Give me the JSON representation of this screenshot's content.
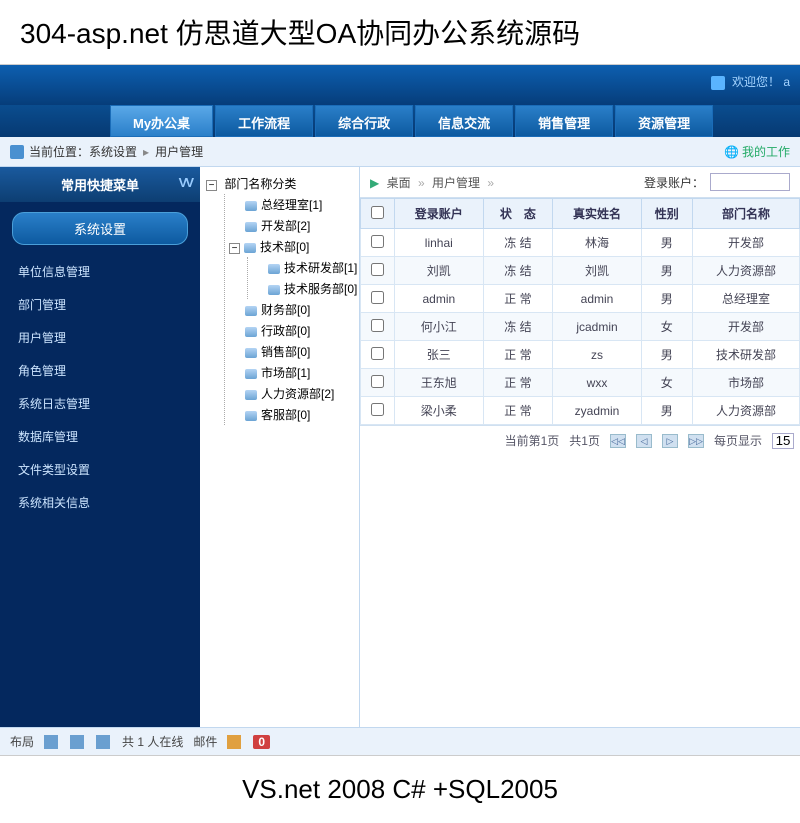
{
  "topTitle": "304-asp.net 仿思道大型OA协同办公系统源码",
  "bottomTitle": "VS.net 2008 C# +SQL2005",
  "welcome": "欢迎您！",
  "welcomeUser": "a",
  "navTabs": [
    "My办公桌",
    "工作流程",
    "综合行政",
    "信息交流",
    "销售管理",
    "资源管理"
  ],
  "location": {
    "label": "当前位置：",
    "path1": "系统设置",
    "path2": "用户管理",
    "myWork": "我的工作"
  },
  "sidebar": {
    "quickMenuTitle": "常用快捷菜单",
    "sysSetting": "系统设置",
    "items": [
      "单位信息管理",
      "部门管理",
      "用户管理",
      "角色管理",
      "系统日志管理",
      "数据库管理",
      "文件类型设置",
      "系统相关信息"
    ]
  },
  "tree": {
    "root": "部门名称分类",
    "nodes": [
      {
        "label": "总经理室[1]",
        "children": []
      },
      {
        "label": "开发部[2]",
        "children": []
      },
      {
        "label": "技术部[0]",
        "expanded": true,
        "children": [
          {
            "label": "技术研发部[1]"
          },
          {
            "label": "技术服务部[0]"
          }
        ]
      },
      {
        "label": "财务部[0]",
        "children": []
      },
      {
        "label": "行政部[0]",
        "children": []
      },
      {
        "label": "销售部[0]",
        "children": []
      },
      {
        "label": "市场部[1]",
        "children": []
      },
      {
        "label": "人力资源部[2]",
        "children": []
      },
      {
        "label": "客服部[0]",
        "children": []
      }
    ]
  },
  "breadcrumb": {
    "desktop": "桌面",
    "current": "用户管理",
    "searchLabel": "登录账户："
  },
  "table": {
    "headers": [
      "",
      "登录账户",
      "状　态",
      "真实姓名",
      "性别",
      "部门名称"
    ],
    "rows": [
      {
        "account": "linhai",
        "status": "冻 结",
        "statusClass": "frozen",
        "realname": "林海",
        "gender": "男",
        "dept": "开发部"
      },
      {
        "account": "刘凯",
        "status": "冻 结",
        "statusClass": "frozen",
        "realname": "刘凯",
        "gender": "男",
        "dept": "人力资源部"
      },
      {
        "account": "admin",
        "status": "正 常",
        "statusClass": "normal",
        "realname": "admin",
        "gender": "男",
        "dept": "总经理室"
      },
      {
        "account": "何小江",
        "status": "冻 结",
        "statusClass": "frozen",
        "realname": "jcadmin",
        "gender": "女",
        "dept": "开发部"
      },
      {
        "account": "张三",
        "status": "正 常",
        "statusClass": "normal",
        "realname": "zs",
        "gender": "男",
        "dept": "技术研发部"
      },
      {
        "account": "王东旭",
        "status": "正 常",
        "statusClass": "normal",
        "realname": "wxx",
        "gender": "女",
        "dept": "市场部"
      },
      {
        "account": "梁小柔",
        "status": "正 常",
        "statusClass": "normal",
        "realname": "zyadmin",
        "gender": "男",
        "dept": "人力资源部"
      }
    ]
  },
  "pager": {
    "current": "当前第1页",
    "total": "共1页",
    "perPage": "每页显示",
    "perPageVal": "15"
  },
  "footer": {
    "layout": "布局",
    "online": "共 1 人在线",
    "mail": "邮件",
    "mailCount": "0"
  }
}
